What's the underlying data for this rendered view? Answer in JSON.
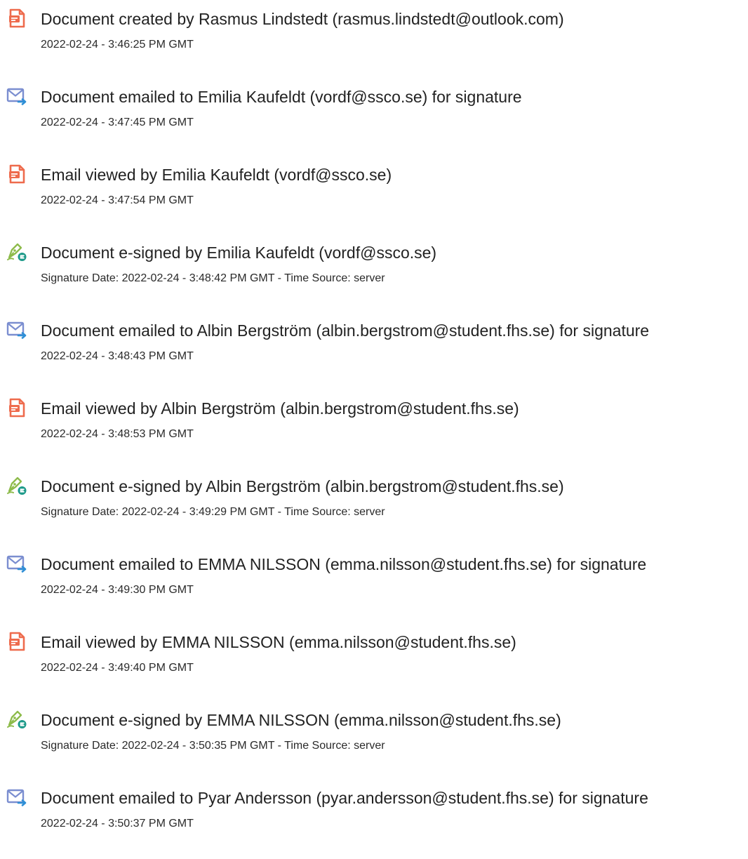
{
  "colors": {
    "created_icon": "#ee6b4d",
    "email_icon": "#7b8ed0",
    "email_arrow": "#2f8fd6",
    "sign_icon": "#8dbb4a",
    "sign_badge": "#1e9a8a",
    "text": "#222222"
  },
  "events": [
    {
      "icon": "document-icon",
      "title": "Document created by Rasmus Lindstedt (rasmus.lindstedt@outlook.com)",
      "detail": "2022-02-24 - 3:46:25 PM GMT"
    },
    {
      "icon": "email-sent-icon",
      "title": "Document emailed to Emilia Kaufeldt (vordf@ssco.se) for signature",
      "detail": "2022-02-24 - 3:47:45 PM GMT"
    },
    {
      "icon": "document-icon",
      "title": "Email viewed by Emilia Kaufeldt (vordf@ssco.se)",
      "detail": "2022-02-24 - 3:47:54 PM GMT"
    },
    {
      "icon": "e-sign-icon",
      "title": "Document e-signed by Emilia Kaufeldt (vordf@ssco.se)",
      "detail": "Signature Date: 2022-02-24 - 3:48:42 PM GMT - Time Source: server"
    },
    {
      "icon": "email-sent-icon",
      "title": "Document emailed to Albin Bergström (albin.bergstrom@student.fhs.se) for signature",
      "detail": "2022-02-24 - 3:48:43 PM GMT"
    },
    {
      "icon": "document-icon",
      "title": "Email viewed by Albin Bergström (albin.bergstrom@student.fhs.se)",
      "detail": "2022-02-24 - 3:48:53 PM GMT"
    },
    {
      "icon": "e-sign-icon",
      "title": "Document e-signed by Albin Bergström (albin.bergstrom@student.fhs.se)",
      "detail": "Signature Date: 2022-02-24 - 3:49:29 PM GMT - Time Source: server"
    },
    {
      "icon": "email-sent-icon",
      "title": "Document emailed to EMMA NILSSON (emma.nilsson@student.fhs.se) for signature",
      "detail": "2022-02-24 - 3:49:30 PM GMT"
    },
    {
      "icon": "document-icon",
      "title": "Email viewed by EMMA NILSSON (emma.nilsson@student.fhs.se)",
      "detail": "2022-02-24 - 3:49:40 PM GMT"
    },
    {
      "icon": "e-sign-icon",
      "title": "Document e-signed by EMMA NILSSON (emma.nilsson@student.fhs.se)",
      "detail": "Signature Date: 2022-02-24 - 3:50:35 PM GMT - Time Source: server"
    },
    {
      "icon": "email-sent-icon",
      "title": "Document emailed to Pyar Andersson (pyar.andersson@student.fhs.se) for signature",
      "detail": "2022-02-24 - 3:50:37 PM GMT"
    }
  ]
}
